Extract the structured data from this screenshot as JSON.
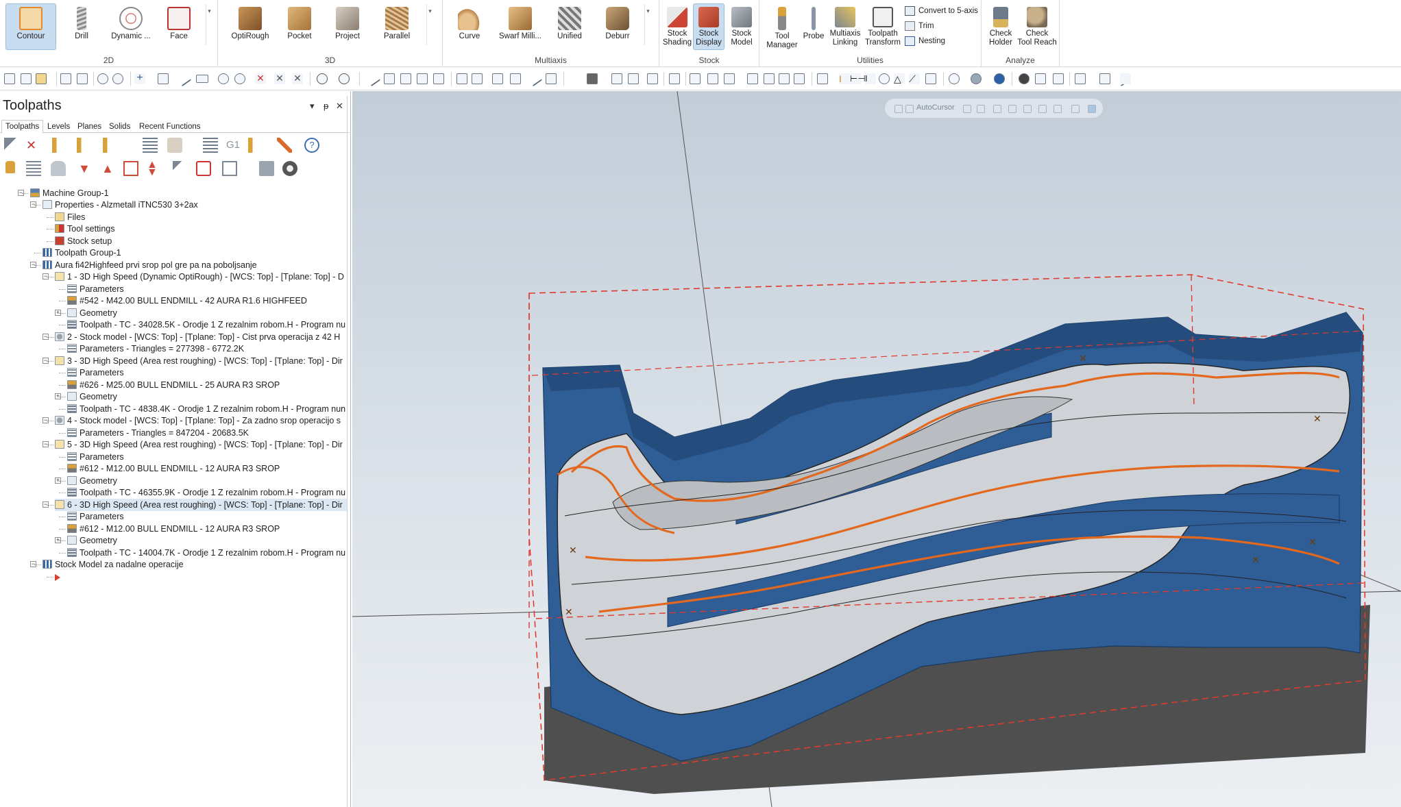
{
  "ribbon": {
    "groups": {
      "g2d": {
        "label": "2D",
        "buttons": {
          "contour": "Contour",
          "drill": "Drill",
          "dynamic": "Dynamic ...",
          "face": "Face"
        }
      },
      "g3d": {
        "label": "3D",
        "buttons": {
          "optirough": "OptiRough",
          "pocket": "Pocket",
          "project": "Project",
          "parallel": "Parallel"
        }
      },
      "multiaxis": {
        "label": "Multiaxis",
        "buttons": {
          "curve": "Curve",
          "swarf": "Swarf Milli...",
          "unified": "Unified",
          "deburr": "Deburr"
        }
      },
      "stock": {
        "label": "Stock",
        "buttons": {
          "shading_l1": "Stock",
          "shading_l2": "Shading",
          "display_l1": "Stock",
          "display_l2": "Display",
          "model_l1": "Stock",
          "model_l2": "Model"
        }
      },
      "utilities": {
        "label": "Utilities",
        "buttons": {
          "tool_l1": "Tool",
          "tool_l2": "Manager",
          "probe": "Probe",
          "ml_l1": "Multiaxis",
          "ml_l2": "Linking",
          "tt_l1": "Toolpath",
          "tt_l2": "Transform",
          "convert": "Convert to 5-axis",
          "trim": "Trim",
          "nesting": "Nesting"
        }
      },
      "analyze": {
        "label": "Analyze",
        "buttons": {
          "ch_l1": "Check",
          "ch_l2": "Holder",
          "ctr_l1": "Check",
          "ctr_l2": "Tool Reach"
        }
      }
    },
    "overflow_glyph": "▾"
  },
  "panel": {
    "title": "Toolpaths",
    "controls": {
      "dropdown": "▾",
      "pin": "ᵽ",
      "close": "✕"
    },
    "tabs": [
      "Toolpaths",
      "Levels",
      "Planes",
      "Solids",
      "Recent Functions"
    ],
    "g1_label": "G1"
  },
  "tree": [
    {
      "label": "Machine Group-1",
      "icon": "machine-icon"
    },
    {
      "label": "Properties - Alzmetall  iTNC530 3+2ax",
      "icon": "properties-icon"
    },
    {
      "label": "Files",
      "icon": "folder-icon"
    },
    {
      "label": "Tool settings",
      "icon": "tool-settings-icon"
    },
    {
      "label": "Stock setup",
      "icon": "stock-setup-icon"
    },
    {
      "label": "Toolpath Group-1",
      "icon": "toolpath-group-icon"
    },
    {
      "label": "Aura fi42Highfeed prvi srop pol gre pa na poboljsanje",
      "icon": "toolpath-group-icon"
    },
    {
      "label": "1 - 3D High Speed (Dynamic OptiRough) - [WCS: Top] - [Tplane: Top] - D",
      "icon": "operation-folder-icon"
    },
    {
      "label": "Parameters",
      "icon": "parameters-icon"
    },
    {
      "label": "#542 - M42.00 BULL ENDMILL - 42 AURA R1.6 HIGHFEED",
      "icon": "tool-icon"
    },
    {
      "label": "Geometry",
      "icon": "geometry-icon"
    },
    {
      "label": "Toolpath - TC - 34028.5K - Orodje 1 Z rezalnim robom.H - Program nu",
      "icon": "toolpath-file-icon"
    },
    {
      "label": "2 - Stock model - [WCS: Top] - [Tplane: Top] - Cist prva operacija z 42 H",
      "icon": "stock-model-icon"
    },
    {
      "label": "Parameters - Triangles =  277398 - 6772.2K",
      "icon": "parameters-icon"
    },
    {
      "label": "3 - 3D High Speed (Area rest roughing) - [WCS: Top] - [Tplane: Top] - Dir",
      "icon": "operation-folder-icon"
    },
    {
      "label": "Parameters",
      "icon": "parameters-icon"
    },
    {
      "label": "#626 - M25.00 BULL ENDMILL - 25 AURA R3 SROP",
      "icon": "tool-icon"
    },
    {
      "label": "Geometry",
      "icon": "geometry-icon"
    },
    {
      "label": "Toolpath - TC - 4838.4K - Orodje 1 Z rezalnim robom.H - Program nun",
      "icon": "toolpath-file-icon"
    },
    {
      "label": "4 - Stock model - [WCS: Top] - [Tplane: Top] - Za zadno srop operacijo s",
      "icon": "stock-model-icon"
    },
    {
      "label": "Parameters - Triangles =  847204 - 20683.5K",
      "icon": "parameters-icon"
    },
    {
      "label": "5 - 3D High Speed (Area rest roughing) - [WCS: Top] - [Tplane: Top] - Dir",
      "icon": "operation-folder-icon"
    },
    {
      "label": "Parameters",
      "icon": "parameters-icon"
    },
    {
      "label": "#612 - M12.00 BULL ENDMILL - 12 AURA R3 SROP",
      "icon": "tool-icon"
    },
    {
      "label": "Geometry",
      "icon": "geometry-icon"
    },
    {
      "label": "Toolpath - TC - 46355.9K - Orodje 1 Z rezalnim robom.H - Program nu",
      "icon": "toolpath-file-icon"
    },
    {
      "label": "6 - 3D High Speed (Area rest roughing) - [WCS: Top] - [Tplane: Top] - Dir",
      "icon": "operation-folder-icon"
    },
    {
      "label": "Parameters",
      "icon": "parameters-icon"
    },
    {
      "label": "#612 - M12.00 BULL ENDMILL - 12 AURA R3 SROP",
      "icon": "tool-icon"
    },
    {
      "label": "Geometry",
      "icon": "geometry-icon"
    },
    {
      "label": "Toolpath - TC - 14004.7K - Orodje 1 Z rezalnim robom.H - Program nu",
      "icon": "toolpath-file-icon"
    },
    {
      "label": "Stock Model za nadalne operacije",
      "icon": "toolpath-group-icon"
    },
    {
      "label": "",
      "icon": "insert-arrow-icon"
    }
  ],
  "viewport": {
    "autocursor_label": "AutoCursor"
  },
  "colors": {
    "active_button": "#c8ddf0",
    "part_blue": "#2f5d96",
    "part_metal": "#d4d6d9",
    "toolpath_orange": "#e3681e",
    "stock_box": "#e03a2e",
    "floor": "#4e4e4e",
    "selection": "#dde8f5"
  }
}
